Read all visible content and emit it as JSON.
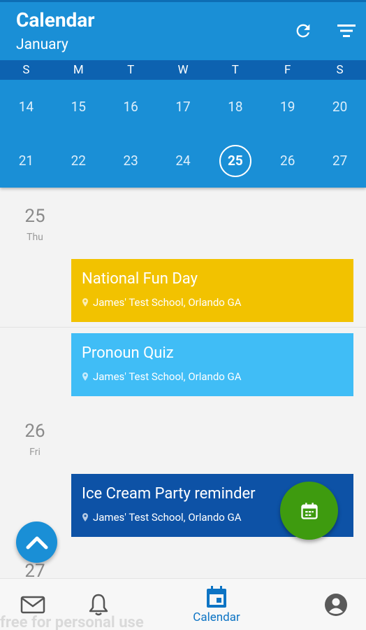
{
  "header": {
    "title": "Calendar",
    "month": "January",
    "refresh_icon": "refresh-icon",
    "filter_icon": "filter-icon"
  },
  "weekdays": [
    "S",
    "M",
    "T",
    "W",
    "T",
    "F",
    "S"
  ],
  "weeks": [
    [
      "14",
      "15",
      "16",
      "17",
      "18",
      "19",
      "20"
    ],
    [
      "21",
      "22",
      "23",
      "24",
      "25",
      "26",
      "27"
    ]
  ],
  "selected_date": "25",
  "agenda": [
    {
      "date_num": "25",
      "date_day": "Thu",
      "events": [
        {
          "title": "National Fun Day",
          "location": "James' Test School, Orlando GA",
          "color": "#f2c200"
        },
        {
          "title": "Pronoun Quiz",
          "location": "James' Test School, Orlando GA",
          "color": "#40bdf6"
        }
      ]
    },
    {
      "date_num": "26",
      "date_day": "Fri",
      "events": [
        {
          "title": "Ice Cream Party reminder",
          "location": "James' Test School, Orlando GA",
          "color": "#0d52a6"
        }
      ]
    },
    {
      "date_num": "27",
      "date_day": "",
      "events": []
    }
  ],
  "fab": {
    "icon": "calendar-add-icon",
    "color": "#3e9b0f"
  },
  "scroll_up": {
    "icon": "chevron-up-icon"
  },
  "bottom_nav": {
    "items": [
      {
        "icon": "mail-icon",
        "label": ""
      },
      {
        "icon": "bell-icon",
        "label": ""
      },
      {
        "icon": "calendar-icon",
        "label": "Calendar",
        "active": true
      },
      {
        "icon": "profile-icon",
        "label": ""
      }
    ]
  },
  "watermark": "free for personal use",
  "colors": {
    "primary": "#1a8fd6",
    "primary_dark": "#0d62b0",
    "active_nav": "#0d74c4"
  }
}
